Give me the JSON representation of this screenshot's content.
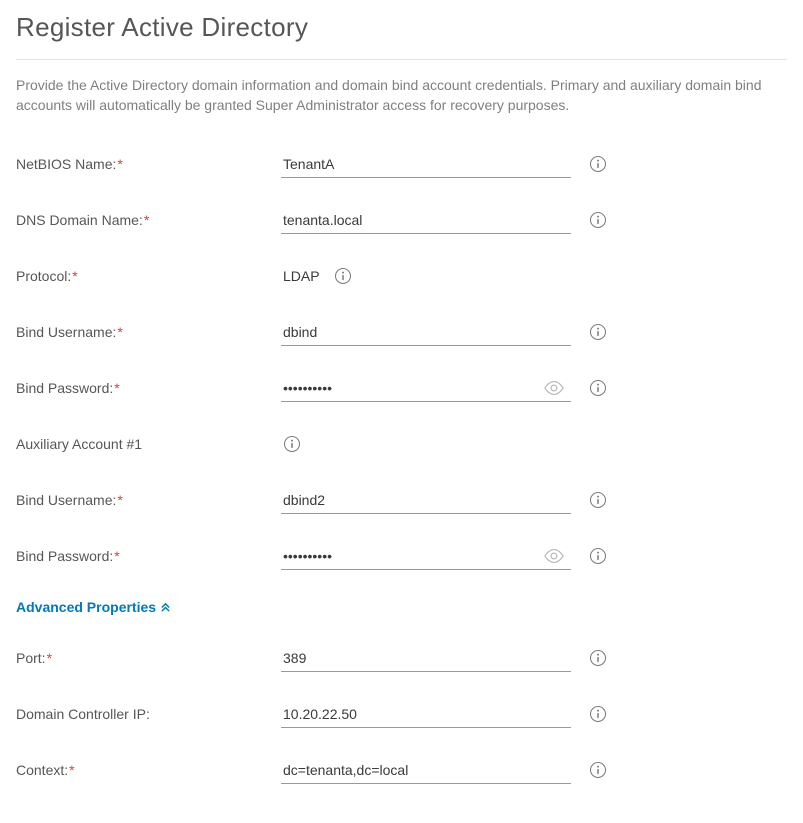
{
  "header": {
    "title": "Register Active Directory"
  },
  "description": "Provide the Active Directory domain information and domain bind account credentials. Primary and auxiliary domain bind accounts will automatically be granted Super Administrator access for recovery purposes.",
  "fields": {
    "netbios": {
      "label": "NetBIOS Name:",
      "required": true,
      "value": "TenantA"
    },
    "dns": {
      "label": "DNS Domain Name:",
      "required": true,
      "value": "tenanta.local"
    },
    "protocol": {
      "label": "Protocol:",
      "required": true,
      "value": "LDAP"
    },
    "bindUser": {
      "label": "Bind Username:",
      "required": true,
      "value": "dbind"
    },
    "bindPass": {
      "label": "Bind Password:",
      "required": true,
      "value": "••••••••••"
    },
    "auxSection": {
      "label": "Auxiliary Account #1"
    },
    "auxUser": {
      "label": "Bind Username:",
      "required": true,
      "value": "dbind2"
    },
    "auxPass": {
      "label": "Bind Password:",
      "required": true,
      "value": "••••••••••"
    },
    "advancedToggle": {
      "label": "Advanced Properties"
    },
    "port": {
      "label": "Port:",
      "required": true,
      "value": "389"
    },
    "dcip": {
      "label": "Domain Controller IP:",
      "required": false,
      "value": "10.20.22.50"
    },
    "context": {
      "label": "Context:",
      "required": true,
      "value": "dc=tenanta,dc=local"
    }
  }
}
